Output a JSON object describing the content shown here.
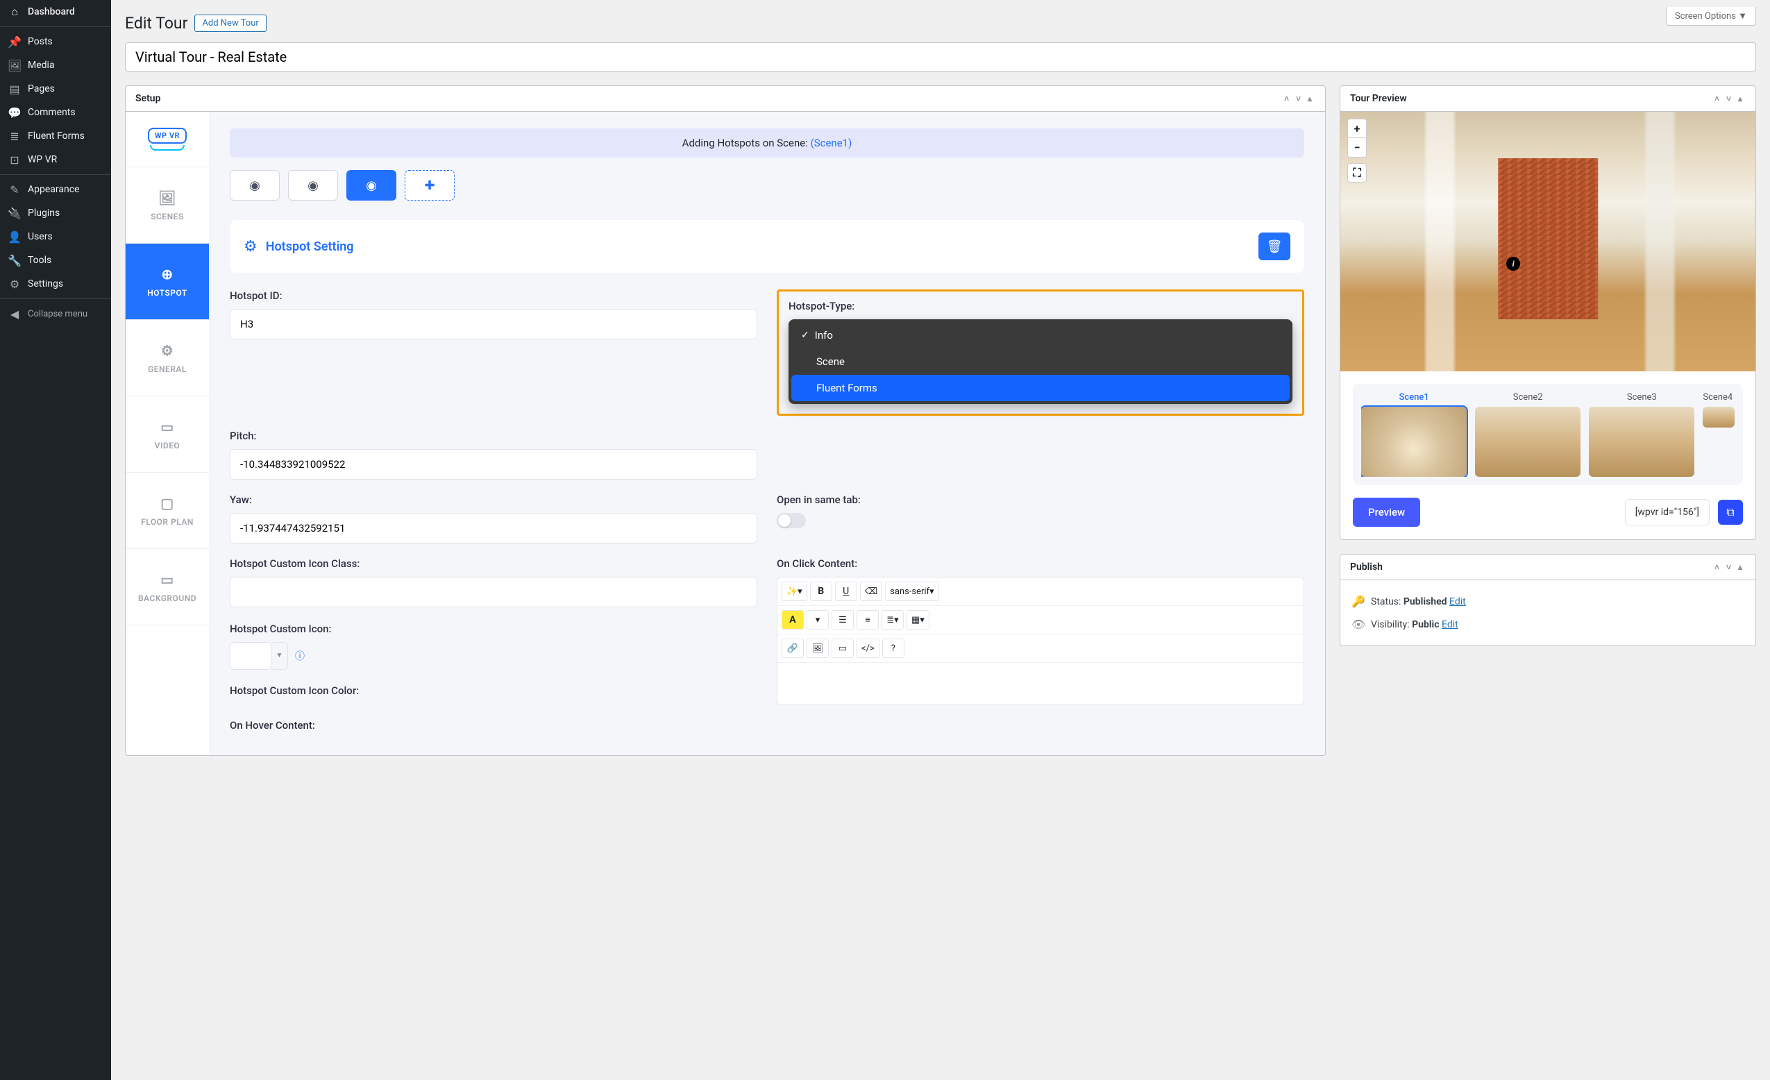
{
  "screen_options": "Screen Options",
  "sidebar": {
    "items": [
      {
        "label": "Dashboard",
        "icon": "⌂"
      },
      {
        "label": "Posts",
        "icon": "📌"
      },
      {
        "label": "Media",
        "icon": "🖼"
      },
      {
        "label": "Pages",
        "icon": "▤"
      },
      {
        "label": "Comments",
        "icon": "💬"
      },
      {
        "label": "Fluent Forms",
        "icon": "≣"
      },
      {
        "label": "WP VR",
        "icon": "⊡"
      },
      {
        "label": "Appearance",
        "icon": "✎"
      },
      {
        "label": "Plugins",
        "icon": "🔌"
      },
      {
        "label": "Users",
        "icon": "👤"
      },
      {
        "label": "Tools",
        "icon": "🔧"
      },
      {
        "label": "Settings",
        "icon": "⚙"
      }
    ],
    "collapse": "Collapse menu"
  },
  "page": {
    "title": "Edit Tour",
    "add_new": "Add New Tour",
    "post_title": "Virtual Tour - Real Estate"
  },
  "setup": {
    "box_title": "Setup",
    "logo_text": "WP VR",
    "tabs": {
      "scenes": "SCENES",
      "hotspot": "HOTSPOT",
      "general": "GENERAL",
      "video": "VIDEO",
      "floor": "FLOOR PLAN",
      "bg": "BACKGROUND"
    },
    "banner_prefix": "Adding Hotspots on Scene: ",
    "banner_scene": "(Scene1)",
    "setting_title": "Hotspot Setting",
    "labels": {
      "hotspot_id": "Hotspot ID:",
      "hotspot_type": "Hotspot-Type:",
      "pitch": "Pitch:",
      "yaw": "Yaw:",
      "open_tab": "Open in same tab:",
      "on_click": "On Click Content:",
      "icon_class": "Hotspot Custom Icon Class:",
      "icon": "Hotspot Custom Icon:",
      "icon_color": "Hotspot Custom Icon Color:",
      "on_hover": "On Hover Content:"
    },
    "values": {
      "hotspot_id": "H3",
      "pitch": "-10.344833921009522",
      "yaw": "-11.937447432592151"
    },
    "type_options": [
      "Info",
      "Scene",
      "Fluent Forms"
    ],
    "editor": {
      "font": "sans-serif"
    }
  },
  "preview": {
    "box_title": "Tour Preview",
    "zoom_in": "+",
    "zoom_out": "−",
    "fullscreen": "⛶",
    "scenes": [
      "Scene1",
      "Scene2",
      "Scene3",
      "Scene4"
    ],
    "preview_btn": "Preview",
    "shortcode": "[wpvr id=\"156\"]"
  },
  "publish": {
    "box_title": "Publish",
    "status_label": "Status: ",
    "status_value": "Published",
    "visibility_label": "Visibility: ",
    "visibility_value": "Public",
    "edit": "Edit"
  }
}
